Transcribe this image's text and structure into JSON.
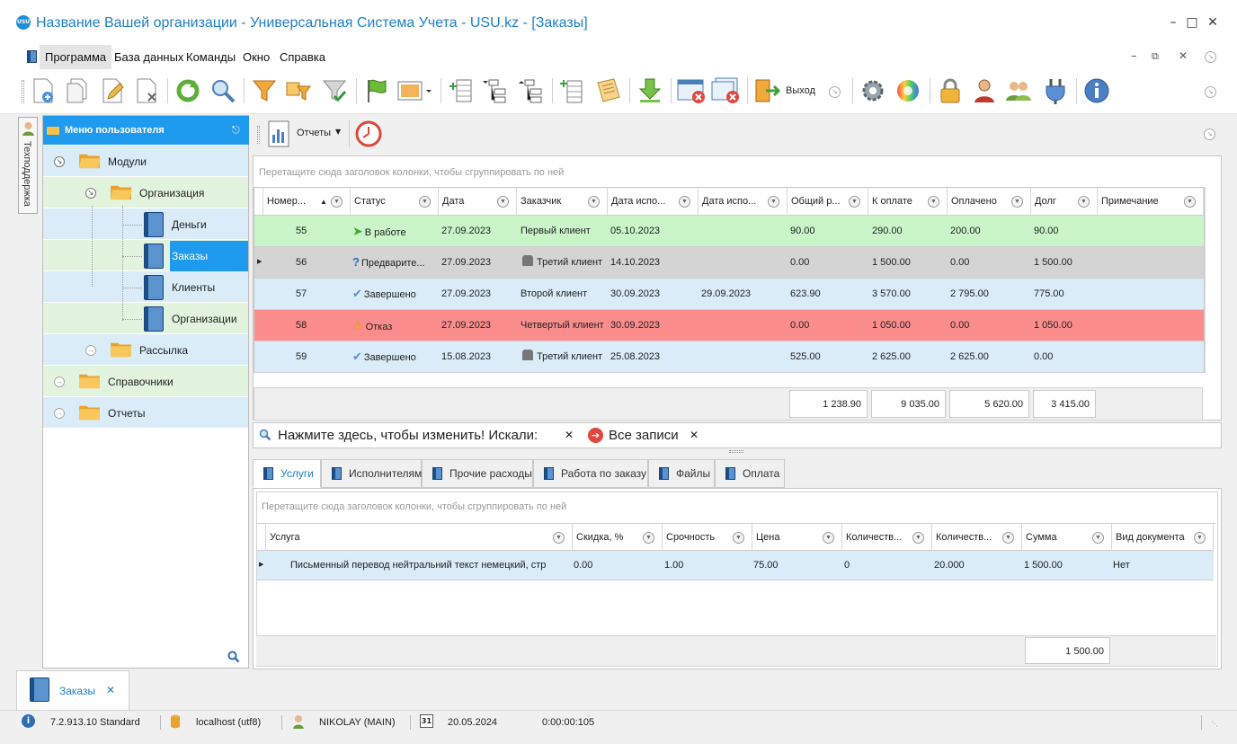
{
  "window": {
    "title": "Название Вашей организации - Универсальная Система Учета - USU.kz - [Заказы]",
    "logo_text": "USU"
  },
  "menu": [
    "Программа",
    "База данных",
    "Команды",
    "Окно",
    "Справка"
  ],
  "toolbar": {
    "exit_label": "Выход"
  },
  "side_strip": {
    "label": "Техподдержка"
  },
  "user_menu": {
    "title": "Меню пользователя",
    "items": [
      {
        "label": "Модули"
      },
      {
        "label": "Организация"
      },
      {
        "label": "Деньги"
      },
      {
        "label": "Заказы"
      },
      {
        "label": "Клиенты"
      },
      {
        "label": "Организации"
      },
      {
        "label": "Рассылка"
      },
      {
        "label": "Справочники"
      },
      {
        "label": "Отчеты"
      }
    ]
  },
  "sub_toolbar": {
    "reports_label": "Отчеты"
  },
  "orders_grid": {
    "group_hint": "Перетащите сюда заголовок колонки, чтобы сгруппировать по ней",
    "columns": [
      "Номер...",
      "Статус",
      "Дата",
      "Заказчик",
      "Дата испо...",
      "Дата испо...",
      "Общий р...",
      "К оплате",
      "Оплачено",
      "Долг",
      "Примечание"
    ],
    "rows": [
      {
        "num": "55",
        "status": "В работе",
        "date": "27.09.2023",
        "client": "Первый клиент",
        "due": "05.10.2023",
        "done": "",
        "total": "90.00",
        "to_pay": "290.00",
        "paid": "200.00",
        "debt": "90.00",
        "note": "",
        "color": "#c9f5c9"
      },
      {
        "num": "56",
        "status": "Предварите...",
        "date": "27.09.2023",
        "client": "Третий клиент",
        "due": "14.10.2023",
        "done": "",
        "total": "0.00",
        "to_pay": "1 500.00",
        "paid": "0.00",
        "debt": "1 500.00",
        "note": "",
        "color": "#d4d4d4"
      },
      {
        "num": "57",
        "status": "Завершено",
        "date": "27.09.2023",
        "client": "Второй клиент",
        "due": "30.09.2023",
        "done": "29.09.2023",
        "total": "623.90",
        "to_pay": "3 570.00",
        "paid": "2 795.00",
        "debt": "775.00",
        "note": "",
        "color": "#d9ecf8"
      },
      {
        "num": "58",
        "status": "Отказ",
        "date": "27.09.2023",
        "client": "Четвертый клиент",
        "due": "30.09.2023",
        "done": "",
        "total": "0.00",
        "to_pay": "1 050.00",
        "paid": "0.00",
        "debt": "1 050.00",
        "note": "",
        "color": "#fb8d8d"
      },
      {
        "num": "59",
        "status": "Завершено",
        "date": "15.08.2023",
        "client": "Третий клиент",
        "due": "25.08.2023",
        "done": "",
        "total": "525.00",
        "to_pay": "2 625.00",
        "paid": "2 625.00",
        "debt": "0.00",
        "note": "",
        "color": "#d9ecf8"
      }
    ],
    "totals": [
      "1 238.90",
      "9 035.00",
      "5 620.00",
      "3 415.00"
    ]
  },
  "filter_bar": {
    "prompt": "Нажмите здесь, чтобы изменить! Искали:",
    "filter": "Все записи"
  },
  "detail_tabs": [
    "Услуги",
    "Исполнителям",
    "Прочие расходы",
    "Работа по заказу",
    "Файлы",
    "Оплата"
  ],
  "services_grid": {
    "group_hint": "Перетащите сюда заголовок колонки, чтобы сгруппировать по ней",
    "columns": [
      "Услуга",
      "Скидка, %",
      "Срочность",
      "Цена",
      "Количеств...",
      "Количеств...",
      "Сумма",
      "Вид документа"
    ],
    "rows": [
      {
        "service": "Письменный перевод нейтральний текст немецкий, стр",
        "discount": "0.00",
        "urgency": "1.00",
        "price": "75.00",
        "qty1": "0",
        "qty2": "20.000",
        "sum": "1 500.00",
        "doc": "Нет"
      }
    ],
    "total": "1 500.00"
  },
  "bottom_tab": {
    "label": "Заказы"
  },
  "status_bar": {
    "version": "7.2.913.10 Standard",
    "db": "localhost (utf8)",
    "user": "NIKOLAY (MAIN)",
    "date": "20.05.2024",
    "timer": "0:00:00:105"
  }
}
